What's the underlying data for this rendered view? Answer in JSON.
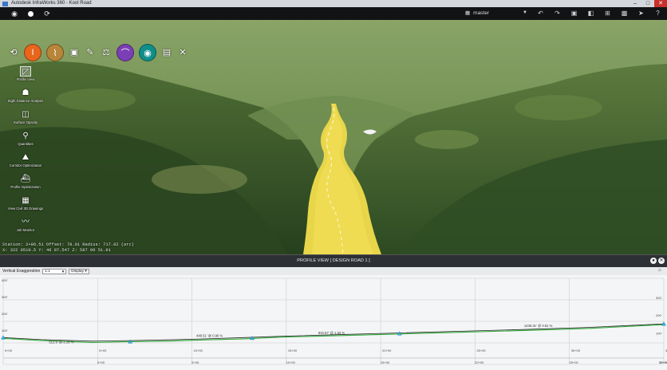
{
  "window": {
    "title": "Autodesk InfraWorks 360 - Kool Road"
  },
  "toolbar": {
    "branch": "master"
  },
  "modes": [
    {
      "name": "home-icon",
      "color": "",
      "glyph": "⟲"
    },
    {
      "name": "road-design-icon",
      "color": "#e8661c",
      "glyph": "I"
    },
    {
      "name": "road-profile-icon",
      "color": "#b8863a",
      "glyph": "⌇"
    },
    {
      "name": "analysis-icon",
      "color": "",
      "glyph": "▣"
    },
    {
      "name": "measure-icon",
      "color": "",
      "glyph": "✎"
    },
    {
      "name": "balance-icon",
      "color": "",
      "glyph": "⚖"
    },
    {
      "name": "bridge-icon",
      "color": "#7b3fb5",
      "glyph": "⌒"
    },
    {
      "name": "drainage-icon",
      "color": "#0f8f8a",
      "glyph": "◉"
    },
    {
      "name": "present-icon",
      "color": "",
      "glyph": "▤"
    },
    {
      "name": "settings-icon",
      "color": "",
      "glyph": "✕"
    }
  ],
  "lefttools": [
    {
      "name": "profile-view-tool",
      "icon": "profile-view-icon",
      "glyph": "◸",
      "label": "Profile View"
    },
    {
      "name": "sight-distance-tool",
      "icon": "sight-distance-icon",
      "glyph": "☗",
      "label": "Sight Distance Analysis"
    },
    {
      "name": "surface-opacity-tool",
      "icon": "surface-opacity-icon",
      "glyph": "◫",
      "label": "Surface Opacity"
    },
    {
      "name": "quantities-tool",
      "icon": "quantities-icon",
      "glyph": "⚲",
      "label": "Quantities"
    },
    {
      "name": "corridor-optimization-tool",
      "icon": "corridor-optimization-icon",
      "glyph": "⛰",
      "label": "Corridor Optimization"
    },
    {
      "name": "profile-optimization-tool",
      "icon": "profile-optimization-icon",
      "glyph": "⛴",
      "label": "Profile Optimization"
    },
    {
      "name": "view-civil-3d-tool",
      "icon": "civil-3d-icon",
      "glyph": "▦",
      "label": "View Civil 3D Drawings"
    },
    {
      "name": "job-monitor-tool",
      "icon": "job-monitor-icon",
      "glyph": "〰",
      "label": "Job Monitor"
    }
  ],
  "readout": {
    "line1": "Station: 2+96.51  Offset: 78.01  Radius: 717.82 (arc)",
    "line2": "X: 322 0510.5 Y: 46 07.547 Z: 587 06 51.91"
  },
  "profile": {
    "title": "PROFILE VIEW [ DESIGN ROAD 1 ]",
    "vertical_exaggeration_label": "Vertical Exaggeration",
    "vertical_exaggeration_value": "1:1",
    "display_label": "Display"
  },
  "chart_data": {
    "type": "line",
    "xlim": [
      0,
      2600
    ],
    "ylim": [
      120,
      460
    ],
    "yticks_left": [
      "400'",
      "300'",
      "200'",
      "100'"
    ],
    "yticks_right": [
      "300'",
      "200'",
      "100'"
    ],
    "station_labels_top": [
      "0+00",
      "5+00",
      "10+00",
      "15+00",
      "20+00",
      "25+00",
      "30+00",
      "35+00"
    ],
    "station_labels_bottom": [
      "0+00",
      "5+00",
      "10+00",
      "15+00",
      "20+00",
      "25+00",
      "30+00",
      "35+00"
    ],
    "series": [
      {
        "x": [
          0,
          150,
          350,
          500,
          650,
          800,
          950,
          1100,
          1300,
          1550,
          1800,
          2050,
          2300,
          2600
        ],
        "y": [
          226,
          218,
          212,
          214,
          217,
          221,
          226,
          231,
          237,
          244,
          251,
          258,
          266,
          280
        ]
      },
      {
        "x": [
          0,
          150,
          350,
          500,
          650,
          800,
          950,
          1100,
          1300,
          1550,
          1800,
          2050,
          2300,
          2600
        ],
        "y": [
          223,
          214,
          207,
          210,
          212,
          217,
          221,
          228,
          233,
          240,
          247,
          254,
          262,
          277
        ]
      }
    ],
    "pvis": [
      {
        "x": 0,
        "y": 226
      },
      {
        "x": 500,
        "y": 210
      },
      {
        "x": 980,
        "y": 224
      },
      {
        "x": 1560,
        "y": 242
      },
      {
        "x": 2600,
        "y": 280
      }
    ],
    "grade_labels": [
      {
        "text": "512.9' @-1.18 %",
        "x": 180,
        "y": 203
      },
      {
        "text": "448.51' @ 0.96 %",
        "x": 760,
        "y": 228
      },
      {
        "text": "834.57' @ 1.63 %",
        "x": 1240,
        "y": 240
      },
      {
        "text": "1436.31' @ 0.81 %",
        "x": 2050,
        "y": 268
      }
    ]
  }
}
